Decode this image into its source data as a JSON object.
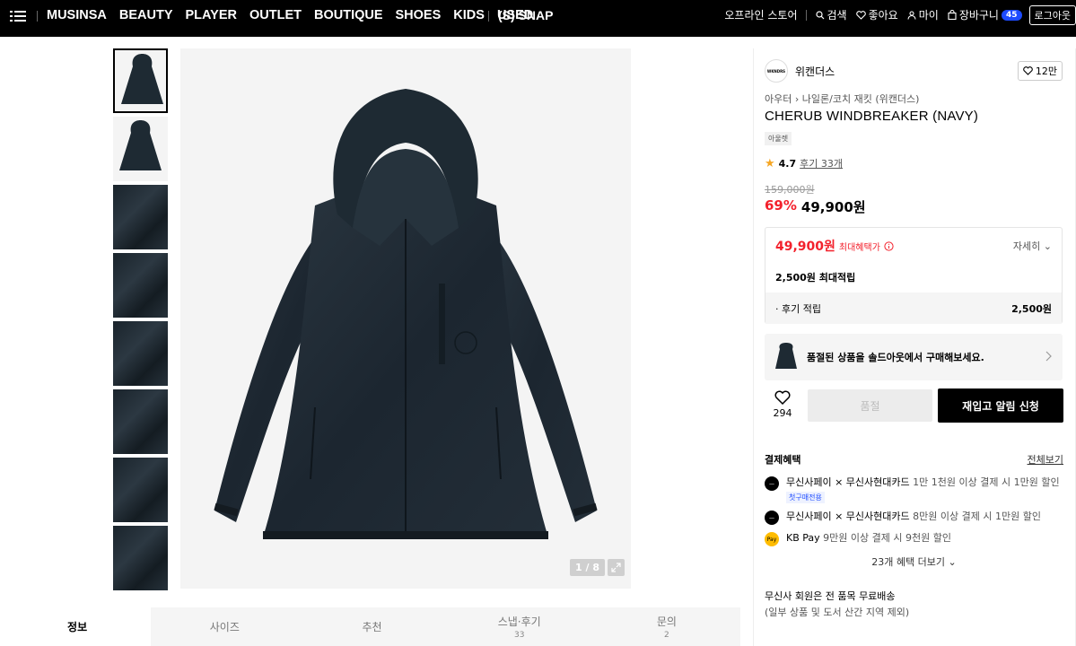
{
  "nav": {
    "links": [
      "MUSINSA",
      "BEAUTY",
      "PLAYER",
      "OUTLET",
      "BOUTIQUE",
      "SHOES",
      "KIDS",
      "USED"
    ],
    "snap": "(S) SNAP",
    "offline_store": "오프라인 스토어",
    "search": "검색",
    "likes": "좋아요",
    "my": "마이",
    "cart": "장바구니",
    "cart_count": "45",
    "login": "로그아웃"
  },
  "gallery": {
    "counter": "1 / 8",
    "thumb_count": 8
  },
  "tabs": [
    {
      "label": "정보",
      "count": ""
    },
    {
      "label": "사이즈",
      "count": ""
    },
    {
      "label": "추천",
      "count": ""
    },
    {
      "label": "스냅·후기",
      "count": "33"
    },
    {
      "label": "문의",
      "count": "2"
    }
  ],
  "product": {
    "brand": "위캔더스",
    "brand_logo_text": "WKNDRS",
    "likes": "12만",
    "breadcrumb": [
      "아우터",
      "나일론/코치 재킷 (위캔더스)"
    ],
    "title": "CHERUB WINDBREAKER (NAVY)",
    "tag": "아울렛",
    "rating": "4.7",
    "reviews": "후기 33개",
    "original_price": "159,000원",
    "discount": "69%",
    "sale_price": "49,900원",
    "benefit_price": "49,900원",
    "benefit_label": "최대혜택가",
    "benefit_detail": "자세히",
    "points": "2,500원 최대적립",
    "review_points_label": "· 후기 적립",
    "review_points": "2,500원",
    "soldout_msg": "품절된 상품을 솔드아웃에서 구매해보세요.",
    "heart_count": "294",
    "sold_label": "품절",
    "restock_label": "재입고 알림 신청"
  },
  "payment": {
    "title": "결제혜택",
    "view_all": "전체보기",
    "rows": [
      {
        "bold": "무신사페이 × 무신사현대카드",
        "rest": " 1만 1천원 이상 결제 시 1만원 할인",
        "badge": "첫구매전용"
      },
      {
        "bold": "무신사페이 × 무신사현대카드",
        "rest": " 8만원 이상 결제 시 1만원 할인",
        "badge": ""
      },
      {
        "bold": "KB Pay",
        "rest": " 9만원 이상 결제 시 9천원 할인",
        "badge": ""
      }
    ],
    "more": "23개 혜택 더보기",
    "shipping1": "무신사 회원은 전 품목 무료배송",
    "shipping2": "(일부 상품 및 도서 산간 지역 제외)"
  },
  "colors": {
    "accent": "#f3212c",
    "badge_blue": "#1d4bff",
    "jacket": "#1f2a33"
  }
}
